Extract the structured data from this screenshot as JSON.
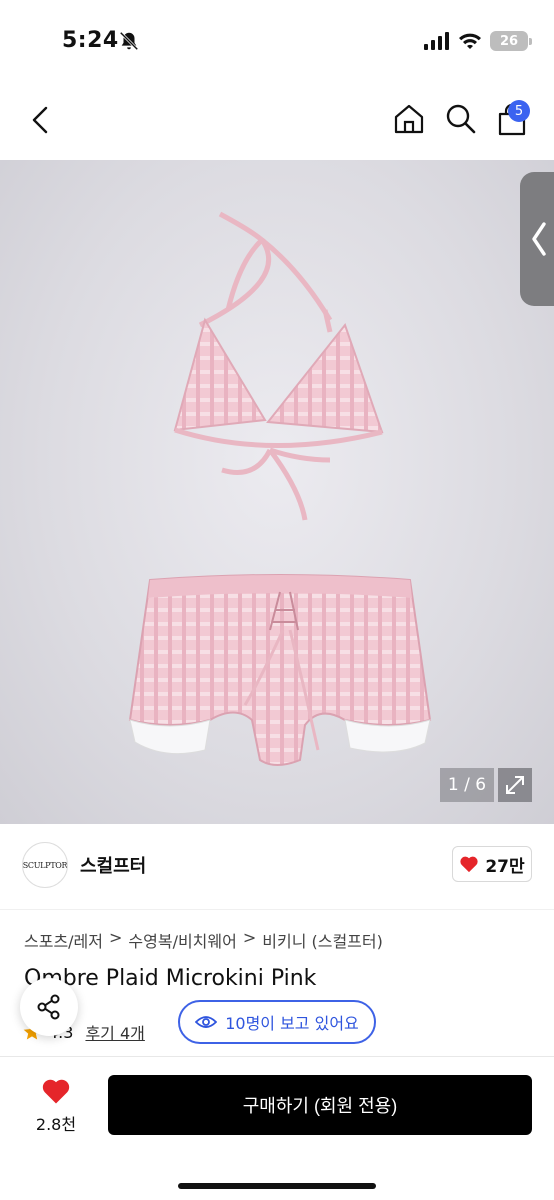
{
  "status_bar": {
    "time": "5:24",
    "battery": "26",
    "icons": [
      "bell-slash-icon",
      "signal-icon",
      "wifi-icon",
      "battery-icon"
    ]
  },
  "nav": {
    "cart_count": "5",
    "icons": [
      "back-icon",
      "home-icon",
      "search-icon",
      "cart-icon"
    ]
  },
  "gallery": {
    "counter": "1 / 6",
    "current": 1,
    "total": 6
  },
  "seller": {
    "logo_text": "SCULPTOR",
    "name": "스컬프터",
    "likes": "27만"
  },
  "breadcrumb": [
    "스포츠/레저",
    "수영복/비치웨어",
    "비키니 (스컬프터)"
  ],
  "breadcrumb_sep": ">",
  "product": {
    "title": "Ombre Plaid Microkini Pink",
    "rating": "4.3",
    "reviews": "후기 4개"
  },
  "viewers": "10명이 보고 있어요",
  "bottom": {
    "wish_count": "2.8천",
    "buy_label": "구매하기 (회원 전용)"
  },
  "colors": {
    "accent_blue": "#3b63f0",
    "heart_red": "#e5252a",
    "star_orange": "#f4a100",
    "buy_bg": "#000000"
  }
}
